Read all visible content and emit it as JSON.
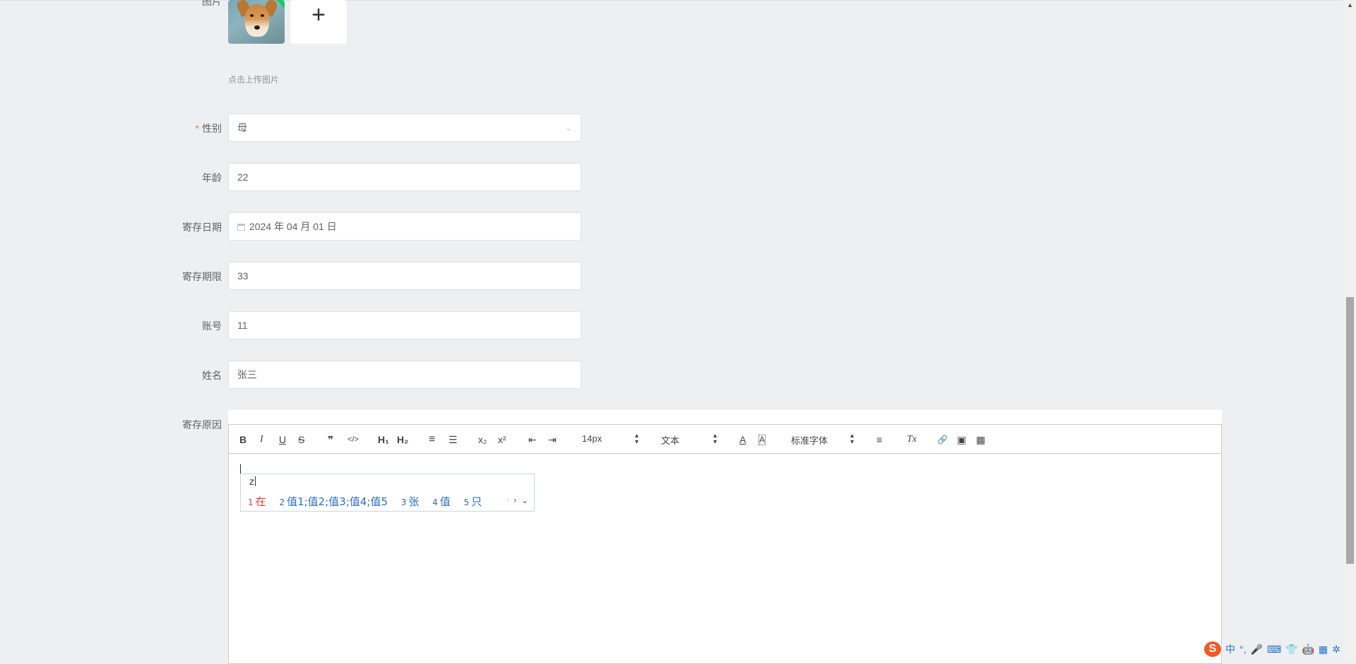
{
  "form": {
    "image_label": "图片",
    "upload_plus": "+",
    "upload_hint": "点击上传图片",
    "gender": {
      "label": "性别",
      "required_mark": "*",
      "value": "母"
    },
    "age": {
      "label": "年龄",
      "value": "22"
    },
    "deposit_date": {
      "label": "寄存日期",
      "value": "2024 年 04 月 01 日"
    },
    "deposit_period": {
      "label": "寄存期限",
      "value": "33"
    },
    "account": {
      "label": "账号",
      "value": "11"
    },
    "name": {
      "label": "姓名",
      "value": "张三"
    },
    "reason": {
      "label": "寄存原因"
    }
  },
  "editor": {
    "toolbar": {
      "bold": "B",
      "italic": "I",
      "underline": "U",
      "strike": "S",
      "blockquote": "❞",
      "code": "</>",
      "h1": "H₁",
      "h2": "H₂",
      "ordered_list": "≡",
      "bullet_list": "☰",
      "subscript": "x₂",
      "superscript": "x²",
      "outdent": "⇤",
      "indent": "⇥",
      "size_select": "14px",
      "header_select": "文本",
      "font_select": "标准字体",
      "align": "≡",
      "clean": "Tx",
      "link": "🔗",
      "image": "▣",
      "video": "▦"
    }
  },
  "ime": {
    "input": "z",
    "candidates": [
      {
        "num": "1",
        "text": "在"
      },
      {
        "num": "2",
        "text": "值1;值2;值3;值4;值5"
      },
      {
        "num": "3",
        "text": "张"
      },
      {
        "num": "4",
        "text": "值"
      },
      {
        "num": "5",
        "text": "只"
      }
    ],
    "prev": "‹",
    "next": "›",
    "expand": "⌄"
  },
  "tray": {
    "logo": "S",
    "lang": "中",
    "punct": "°,",
    "mic": "🎤",
    "keyboard": "⌨",
    "skin": "👕",
    "robot": "🤖",
    "grid": "▦",
    "settings": "✲"
  },
  "colors": {
    "required": "#f56c6c",
    "ime_first": "#e33b2e",
    "ime_cand": "#2a6dc5",
    "sogou": "#f15a24"
  }
}
